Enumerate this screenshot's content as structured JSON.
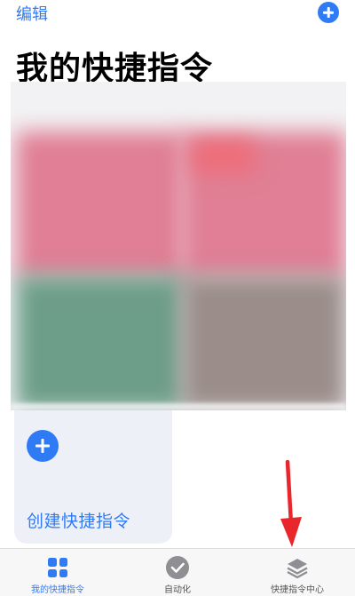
{
  "header": {
    "edit_label": "编辑",
    "title": "我的快捷指令"
  },
  "create_card": {
    "label": "创建快捷指令"
  },
  "tabs": [
    {
      "label": "我的快捷指令",
      "icon": "grid-icon",
      "selected": true
    },
    {
      "label": "自动化",
      "icon": "checkmark-circle-icon",
      "selected": false
    },
    {
      "label": "快捷指令中心",
      "icon": "layers-icon",
      "selected": false
    }
  ],
  "colors": {
    "accent": "#2f7bf6",
    "arrow": "#e8262b",
    "inactive_tab": "#8e8e93"
  }
}
